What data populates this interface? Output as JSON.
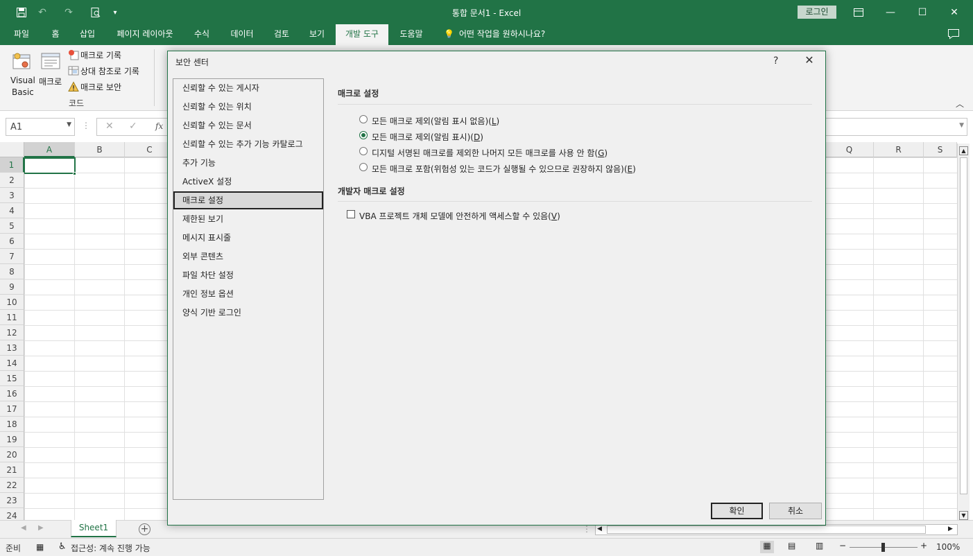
{
  "window": {
    "title": "통합 문서1  -  Excel",
    "login_label": "로그인",
    "colors": {
      "brand": "#217346",
      "ribbon_bg": "#f3f3f3"
    }
  },
  "ribbon": {
    "tabs": [
      "파일",
      "홈",
      "삽입",
      "페이지 레이아웃",
      "수식",
      "데이터",
      "검토",
      "보기",
      "개발 도구",
      "도움말"
    ],
    "active_tab": "개발 도구",
    "tell_me": "어떤 작업을 원하시나요?",
    "code_group": {
      "visual_basic_label_1": "Visual",
      "visual_basic_label_2": "Basic",
      "macros_label": "매크로",
      "record_macro": "매크로 기록",
      "relative_refs": "상대 참조로 기록",
      "macro_security": "매크로 보안",
      "group_name": "코드"
    }
  },
  "formula_bar": {
    "name_box": "A1",
    "fx": "fx"
  },
  "grid": {
    "left_columns": [
      "A",
      "B",
      "C"
    ],
    "right_columns": [
      "Q",
      "R",
      "S"
    ],
    "rows": [
      "1",
      "2",
      "3",
      "4",
      "5",
      "6",
      "7",
      "8",
      "9",
      "10",
      "11",
      "12",
      "13",
      "14",
      "15",
      "16",
      "17",
      "18",
      "19",
      "20",
      "21",
      "22",
      "23",
      "24"
    ],
    "active_cell": "A1"
  },
  "sheet_tabs": {
    "sheets": [
      "Sheet1"
    ]
  },
  "status_bar": {
    "ready": "준비",
    "accessibility": "접근성: 계속 진행 가능",
    "zoom": "100%"
  },
  "dialog": {
    "title": "보안 센터",
    "help": "?",
    "nav_items": [
      "신뢰할 수 있는 게시자",
      "신뢰할 수 있는 위치",
      "신뢰할 수 있는 문서",
      "신뢰할 수 있는 추가 기능 카탈로그",
      "추가 기능",
      "ActiveX 설정",
      "매크로 설정",
      "제한된 보기",
      "메시지 표시줄",
      "외부 콘텐츠",
      "파일 차단 설정",
      "개인 정보 옵션",
      "양식 기반 로그인"
    ],
    "selected_nav": "매크로 설정",
    "macro_section_title": "매크로 설정",
    "macro_options": [
      {
        "label": "모든 매크로 제외(알림 표시 없음)",
        "key": "L",
        "selected": false
      },
      {
        "label": "모든 매크로 제외(알림 표시)",
        "key": "D",
        "selected": true
      },
      {
        "label": "디지털 서명된 매크로를 제외한 나머지 모든 매크로를 사용 안 함",
        "key": "G",
        "selected": false
      },
      {
        "label": "모든 매크로 포함(위험성 있는 코드가 실행될 수 있으므로 권장하지 않음)",
        "key": "E",
        "selected": false
      }
    ],
    "dev_section_title": "개발자 매크로 설정",
    "vba_access_label": "VBA 프로젝트 개체 모델에 안전하게 액세스할 수 있음",
    "vba_access_key": "V",
    "vba_access_checked": false,
    "ok_label": "확인",
    "cancel_label": "취소"
  }
}
